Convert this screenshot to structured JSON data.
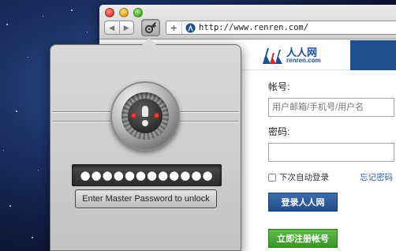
{
  "browser": {
    "url": "http://www.renren.com/",
    "url_plus": "+",
    "back_glyph": "◀",
    "forward_glyph": "▶"
  },
  "site": {
    "logo_cn": "人人网",
    "logo_en": "renren.com",
    "account_label": "帐号:",
    "account_placeholder": "用户邮箱/手机号/用户名",
    "password_label": "密码:",
    "remember_label": "下次自动登录",
    "forgot_link": "忘记密码",
    "login_button": "登录人人网",
    "register_button": "立即注册帐号",
    "brand_color": "#1f4f8f"
  },
  "onepassword": {
    "password_mask": "●●●●●●●●●●●●",
    "unlock_button": "Enter Master Password to unlock",
    "led_color": "#ff3b2f"
  },
  "icons": {
    "lock": "1password-lock-icon",
    "extension": "1password-extension-icon",
    "site": "renren-site-icon"
  }
}
